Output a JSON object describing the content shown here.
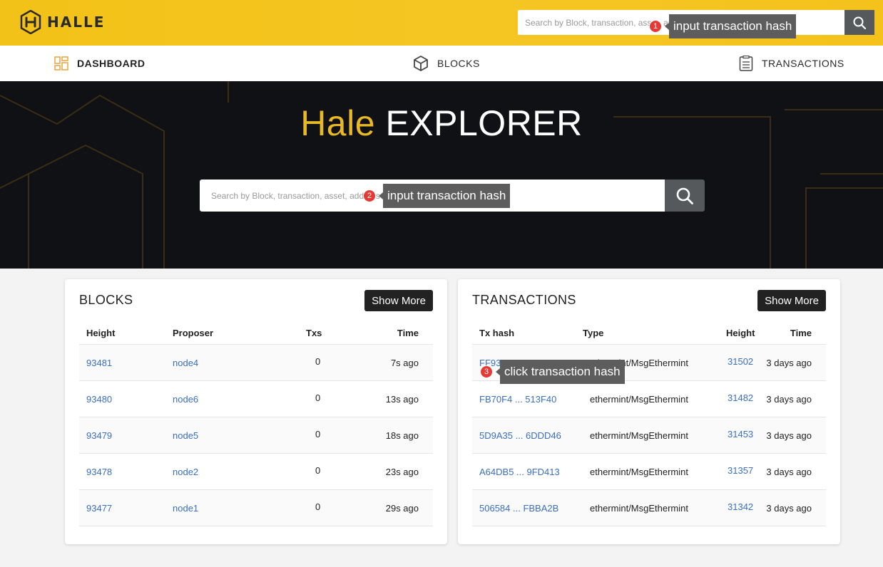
{
  "header": {
    "brand": "HALLE",
    "search_placeholder": "Search by Block, transaction, asset, address"
  },
  "nav": {
    "dashboard": "DASHBOARD",
    "blocks": "BLOCKS",
    "transactions": "TRANSACTIONS"
  },
  "hero": {
    "title_part1": "Hale",
    "title_part2": "EXPLORER",
    "search_placeholder": "Search by Block, transaction, asset, address"
  },
  "blocks_card": {
    "title": "BLOCKS",
    "show_more": "Show More",
    "columns": [
      "Height",
      "Proposer",
      "Txs",
      "Time"
    ],
    "rows": [
      {
        "height": "93481",
        "proposer": "node4",
        "txs": "0",
        "time": "7s ago"
      },
      {
        "height": "93480",
        "proposer": "node6",
        "txs": "0",
        "time": "13s ago"
      },
      {
        "height": "93479",
        "proposer": "node5",
        "txs": "0",
        "time": "18s ago"
      },
      {
        "height": "93478",
        "proposer": "node2",
        "txs": "0",
        "time": "23s ago"
      },
      {
        "height": "93477",
        "proposer": "node1",
        "txs": "0",
        "time": "29s ago"
      }
    ]
  },
  "tx_card": {
    "title": "TRANSACTIONS",
    "show_more": "Show More",
    "columns": [
      "Tx hash",
      "Type",
      "Height",
      "Time"
    ],
    "rows": [
      {
        "hash": "FF9383 ... 2D5855",
        "type": "ethermint/MsgEthermint",
        "height": "31502",
        "time": "3 days ago"
      },
      {
        "hash": "FB70F4 ... 513F40",
        "type": "ethermint/MsgEthermint",
        "height": "31482",
        "time": "3 days ago"
      },
      {
        "hash": "5D9A35 ... 6DDD46",
        "type": "ethermint/MsgEthermint",
        "height": "31453",
        "time": "3 days ago"
      },
      {
        "hash": "A64DB5 ... 9FD413",
        "type": "ethermint/MsgEthermint",
        "height": "31357",
        "time": "3 days ago"
      },
      {
        "hash": "506584 ... FBBA2B",
        "type": "ethermint/MsgEthermint",
        "height": "31342",
        "time": "3 days ago"
      }
    ]
  },
  "annotations": [
    {
      "num": "1",
      "text": "input transaction hash"
    },
    {
      "num": "2",
      "text": "input transaction hash"
    },
    {
      "num": "3",
      "text": "click transaction hash"
    }
  ],
  "colors": {
    "brand_yellow": "#f4c41e",
    "hero_bg": "#0f1115",
    "link_blue": "#3a6fc2",
    "accent_gold": "#e8b825"
  },
  "icons": [
    "halle-logo-icon",
    "search-icon",
    "dashboard-icon",
    "cube-icon",
    "document-list-icon"
  ]
}
